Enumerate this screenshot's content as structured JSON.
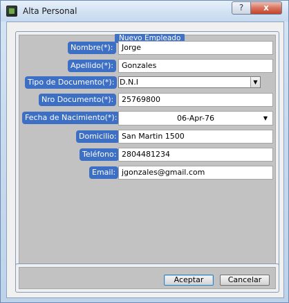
{
  "window": {
    "title": "Alta Personal",
    "help_label": "?",
    "close_label": "x"
  },
  "group": {
    "title": "Nuevo Empleado"
  },
  "form": {
    "nombre": {
      "label": "Nombre(*):",
      "value": "Jorge"
    },
    "apellido": {
      "label": "Apellido(*):",
      "value": "Gonzales"
    },
    "tipo_documento": {
      "label": "Tipo de Documento(*):",
      "value": "D.N.I"
    },
    "nro_documento": {
      "label": "Nro Documento(*):",
      "value": "25769800"
    },
    "fecha_nacimiento": {
      "label": "Fecha de Nacimiento(*):",
      "value": "06-Apr-76"
    },
    "domicilio": {
      "label": "Domicilio:",
      "value": "San Martin 1500"
    },
    "telefono": {
      "label": "Teléfono:",
      "value": "2804481234"
    },
    "email": {
      "label": "Email:",
      "value": "jgonzales@gmail.com"
    }
  },
  "buttons": {
    "aceptar": "Aceptar",
    "cancelar": "Cancelar"
  },
  "colors": {
    "label_bg": "#3d6fc4",
    "panel_bg": "#c2c2c2"
  }
}
